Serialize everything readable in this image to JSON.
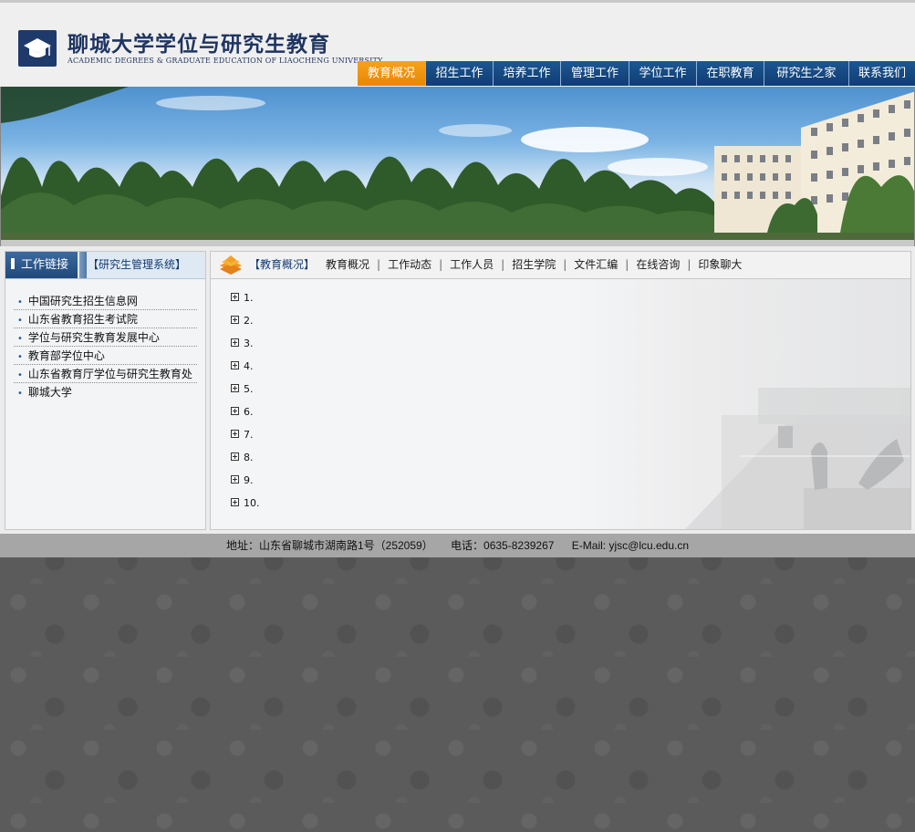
{
  "header": {
    "logo_cn": "聊城大学学位与研究生教育",
    "logo_en": "ACADEMIC DEGREES & GRADUATE EDUCATION OF LIAOCHENG UNIVERSITY",
    "nav": [
      {
        "label": "教育概况",
        "active": true
      },
      {
        "label": "招生工作",
        "active": false
      },
      {
        "label": "培养工作",
        "active": false
      },
      {
        "label": "管理工作",
        "active": false
      },
      {
        "label": "学位工作",
        "active": false
      },
      {
        "label": "在职教育",
        "active": false
      },
      {
        "label": "研究生之家",
        "active": false
      },
      {
        "label": "联系我们",
        "active": false
      }
    ]
  },
  "sidebar": {
    "tab_label": "工作链接",
    "system_link": "【研究生管理系统】",
    "links": [
      "中国研究生招生信息网",
      "山东省教育招生考试院",
      "学位与研究生教育发展中心",
      "教育部学位中心",
      "山东省教育厅学位与研究生教育处",
      "聊城大学"
    ]
  },
  "main": {
    "current": "【教育概况】",
    "subnav": [
      "教育概况",
      "工作动态",
      "工作人员",
      "招生学院",
      "文件汇编",
      "在线咨询",
      "印象聊大"
    ],
    "items": [
      "1.",
      "2.",
      "3.",
      "4.",
      "5.",
      "6.",
      "7.",
      "8.",
      "9.",
      "10."
    ]
  },
  "footer": {
    "address": "地址：山东省聊城市湖南路1号（252059）",
    "phone": "电话：0635-8239267",
    "email": "E-Mail: yjsc@lcu.edu.cn"
  },
  "colors": {
    "nav_blue": "#0f3d73",
    "nav_active": "#e88704",
    "panel_blue": "#21497a",
    "footer_gray": "#a6a6a6"
  }
}
